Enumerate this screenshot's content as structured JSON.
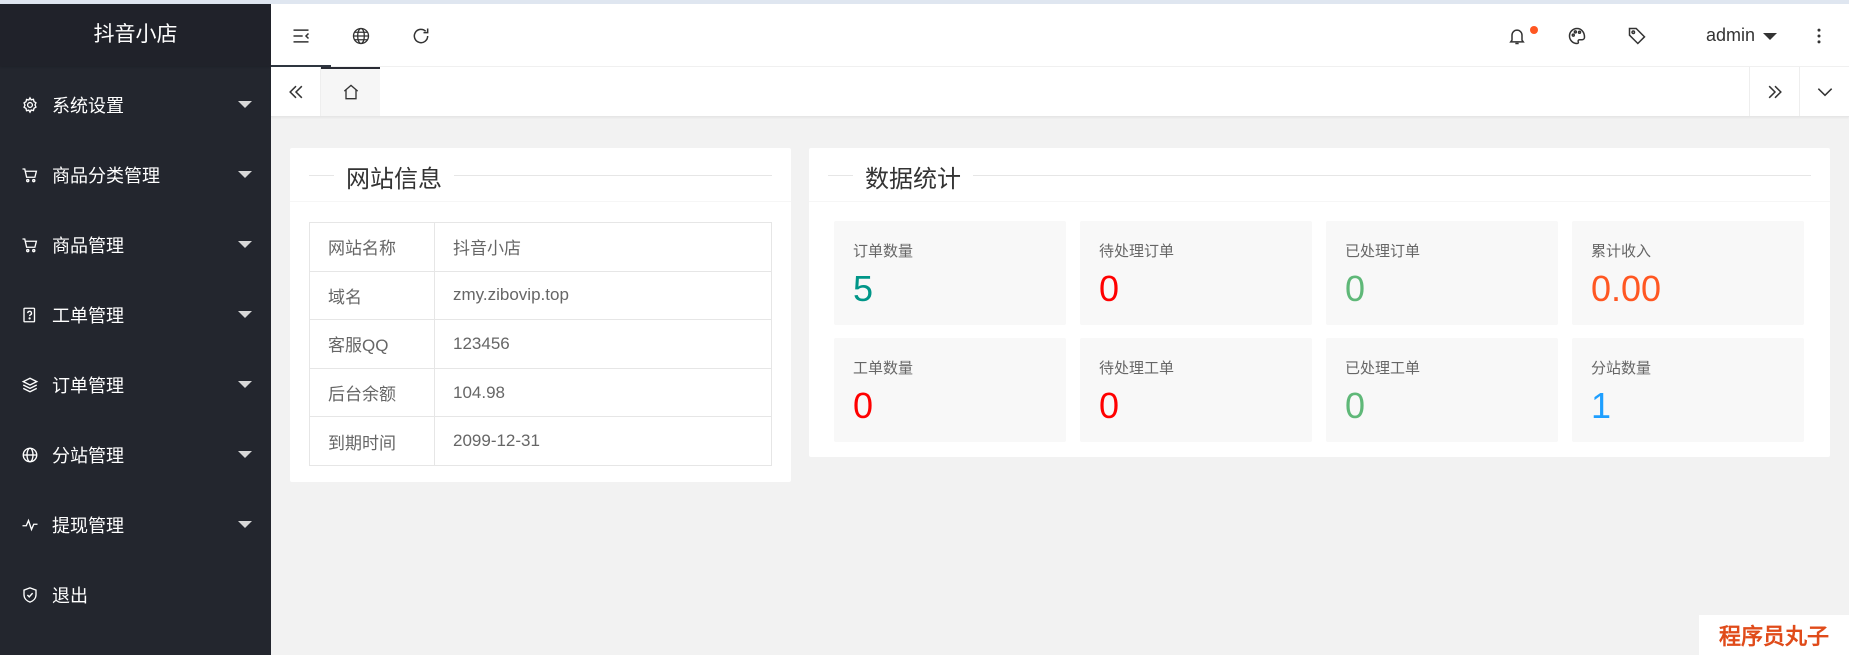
{
  "app": {
    "title": "抖音小店"
  },
  "sidebar": {
    "items": [
      {
        "label": "系统设置",
        "icon": "gear-icon",
        "expandable": true
      },
      {
        "label": "商品分类管理",
        "icon": "cart-icon",
        "expandable": true
      },
      {
        "label": "商品管理",
        "icon": "cart-icon",
        "expandable": true
      },
      {
        "label": "工单管理",
        "icon": "ticket-icon",
        "expandable": true
      },
      {
        "label": "订单管理",
        "icon": "layers-icon",
        "expandable": true
      },
      {
        "label": "分站管理",
        "icon": "globe-icon",
        "expandable": true
      },
      {
        "label": "提现管理",
        "icon": "pulse-icon",
        "expandable": true
      },
      {
        "label": "退出",
        "icon": "shield-check-icon",
        "expandable": false
      }
    ]
  },
  "header": {
    "user": "admin",
    "icons": [
      "menu-fold-icon",
      "globe-icon",
      "refresh-icon",
      "bell-icon",
      "palette-icon",
      "tag-icon",
      "more-vertical-icon"
    ],
    "notice_dot_color": "#ff5722"
  },
  "tabs": {
    "home_icon": "home-icon"
  },
  "site_info": {
    "title": "网站信息",
    "rows": [
      {
        "key": "网站名称",
        "value": "抖音小店"
      },
      {
        "key": "域名",
        "value": "zmy.zibovip.top"
      },
      {
        "key": "客服QQ",
        "value": "123456"
      },
      {
        "key": "后台余额",
        "value": "104.98"
      },
      {
        "key": "到期时间",
        "value": "2099-12-31"
      }
    ]
  },
  "stats": {
    "title": "数据统计",
    "items": [
      {
        "label": "订单数量",
        "value": "5",
        "color": "#009688"
      },
      {
        "label": "待处理订单",
        "value": "0",
        "color": "#ff0000"
      },
      {
        "label": "已处理订单",
        "value": "0",
        "color": "#5fb878"
      },
      {
        "label": "累计收入",
        "value": "0.00",
        "color": "#ff5722"
      },
      {
        "label": "工单数量",
        "value": "0",
        "color": "#ff0000"
      },
      {
        "label": "待处理工单",
        "value": "0",
        "color": "#ff0000"
      },
      {
        "label": "已处理工单",
        "value": "0",
        "color": "#5fb878"
      },
      {
        "label": "分站数量",
        "value": "1",
        "color": "#1e9fff"
      }
    ]
  },
  "watermark": {
    "text": "程序员丸子"
  }
}
